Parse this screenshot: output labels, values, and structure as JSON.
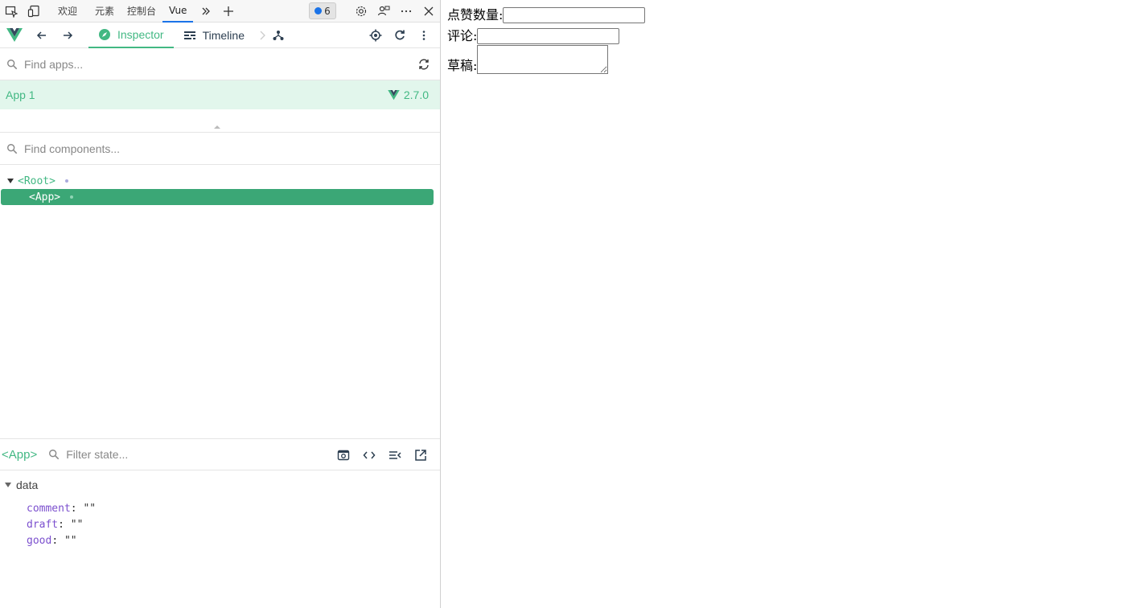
{
  "edge_tabs": [
    "欢迎",
    "元素",
    "控制台",
    "Vue"
  ],
  "edge_badge": "6",
  "vue_tabs": {
    "inspector": "Inspector",
    "timeline": "Timeline"
  },
  "apps_search": {
    "placeholder": "Find apps..."
  },
  "app": {
    "name": "App 1",
    "version": "2.7.0"
  },
  "components_search": {
    "placeholder": "Find components..."
  },
  "tree": {
    "root": "<Root>",
    "app": "<App>"
  },
  "selected_component": "<App>",
  "state_search": {
    "placeholder": "Filter state..."
  },
  "data_section": "data",
  "data_props": [
    {
      "key": "comment",
      "value": "\"\""
    },
    {
      "key": "draft",
      "value": "\"\""
    },
    {
      "key": "good",
      "value": "\"\""
    }
  ],
  "page": {
    "likes_label": "点赞数量:",
    "comment_label": "评论:",
    "draft_label": "草稿:"
  },
  "colors": {
    "vue_green": "#42b883",
    "selected_row": "#3ba776",
    "app_row_bg": "#e2f6ec"
  }
}
